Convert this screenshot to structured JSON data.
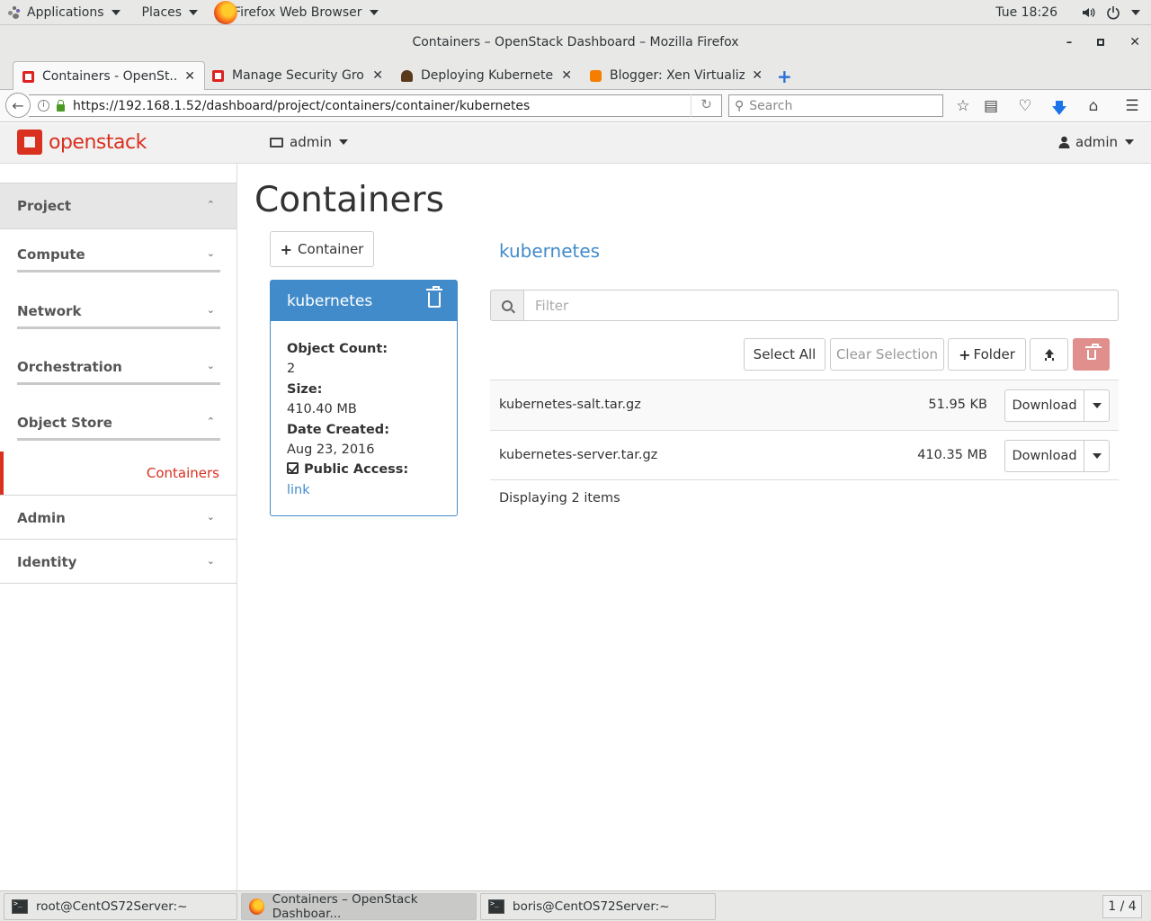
{
  "system_bar": {
    "applications": "Applications",
    "places": "Places",
    "active_app": "Firefox Web Browser",
    "clock": "Tue 18:26"
  },
  "window": {
    "title": "Containers – OpenStack Dashboard – Mozilla Firefox"
  },
  "tabs": [
    {
      "label": "Containers - OpenSt...",
      "icon": "openstack-favicon",
      "active": true
    },
    {
      "label": "Manage Security Gro...",
      "icon": "openstack-favicon",
      "active": false
    },
    {
      "label": "Deploying Kubernete...",
      "icon": "kubernetes-favicon",
      "active": false
    },
    {
      "label": "Blogger: Xen Virtualiz...",
      "icon": "blogger-favicon",
      "active": false
    }
  ],
  "navbar": {
    "url": "https://192.168.1.52/dashboard/project/containers/container/kubernetes",
    "search_placeholder": "Search"
  },
  "header": {
    "logo": "openstack",
    "project": "admin",
    "user": "admin"
  },
  "sidebar": {
    "project": "Project",
    "compute": "Compute",
    "network": "Network",
    "orchestration": "Orchestration",
    "object_store": "Object Store",
    "containers": "Containers",
    "admin": "Admin",
    "identity": "Identity"
  },
  "main": {
    "title": "Containers",
    "add_container_label": "Container",
    "container_heading": "kubernetes",
    "filter_placeholder": "Filter",
    "select_all_label": "Select All",
    "clear_selection_label": "Clear Selection",
    "add_folder_label": "Folder",
    "displaying": "Displaying 2 items"
  },
  "container_card": {
    "name": "kubernetes",
    "object_count_label": "Object Count:",
    "object_count": "2",
    "size_label": "Size:",
    "size": "410.40 MB",
    "date_label": "Date Created:",
    "date": "Aug 23, 2016",
    "public_label": "Public Access:",
    "public_link": "link"
  },
  "objects": [
    {
      "name": "kubernetes-salt.tar.gz",
      "size": "51.95 KB",
      "action": "Download"
    },
    {
      "name": "kubernetes-server.tar.gz",
      "size": "410.35 MB",
      "action": "Download"
    }
  ],
  "taskbar": {
    "tasks": [
      {
        "label": "root@CentOS72Server:~"
      },
      {
        "label": "Containers – OpenStack Dashboar..."
      },
      {
        "label": "boris@CentOS72Server:~"
      }
    ],
    "workspace": "1 / 4"
  },
  "colors": {
    "accent": "#428bca",
    "brand": "#d9301f",
    "danger_button": "#e08f8c"
  }
}
